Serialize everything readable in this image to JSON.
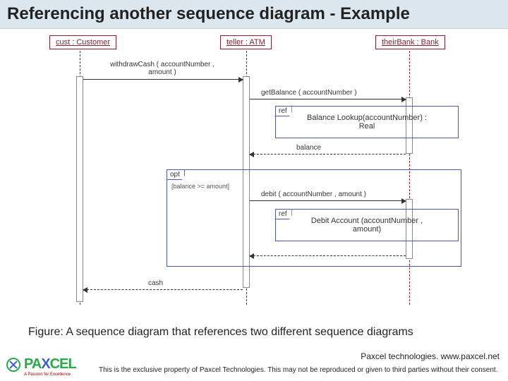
{
  "title": "Referencing another sequence diagram - Example",
  "lifelines": {
    "cust": "cust : Customer",
    "teller": "teller : ATM",
    "bank": "theirBank : Bank"
  },
  "messages": {
    "withdraw_l1": "withdrawCash ( accountNumber ,",
    "withdraw_l2": "amount )",
    "getBalance": "getBalance ( accountNumber )",
    "balance": "balance",
    "debit": "debit ( accountNumber , amount )",
    "cash": "cash"
  },
  "frames": {
    "ref1_tab": "ref",
    "ref1_body_l1": "Balance Lookup(accountNumber) :",
    "ref1_body_l2": "Real",
    "opt_tab": "opt",
    "opt_guard": "[balance >= amount]",
    "ref2_tab": "ref",
    "ref2_body": "Debit Account (accountNumber ,",
    "ref2_body_l2": "amount)"
  },
  "caption": "Figure: A sequence diagram that references two different sequence diagrams",
  "footer": {
    "company": "PAXCEL",
    "tagline": "A Passion for Excellence",
    "credit": "Paxcel technologies. www.paxcel.net",
    "disclaimer": "This is the exclusive property of Paxcel Technologies. This may not be reproduced or given to third parties without their consent."
  }
}
